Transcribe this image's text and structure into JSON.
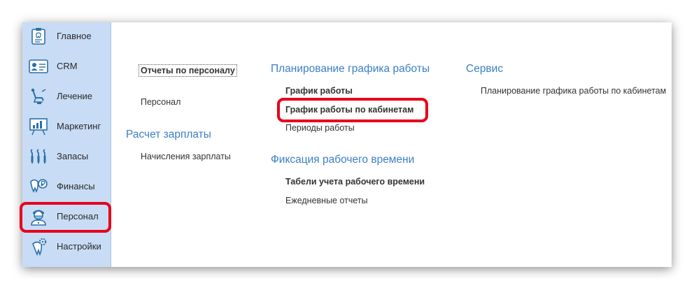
{
  "sidebar": {
    "items": [
      {
        "label": "Главное",
        "icon": "clipboard-tooth-icon"
      },
      {
        "label": "CRM",
        "icon": "contact-card-icon"
      },
      {
        "label": "Лечение",
        "icon": "dental-chair-icon"
      },
      {
        "label": "Маркетинг",
        "icon": "presentation-board-icon"
      },
      {
        "label": "Запасы",
        "icon": "dental-tools-icon"
      },
      {
        "label": "Финансы",
        "icon": "tooth-coin-icon"
      },
      {
        "label": "Персонал",
        "icon": "doctor-icon"
      },
      {
        "label": "Настройки",
        "icon": "tooth-gear-icon"
      }
    ],
    "selected": "Персонал"
  },
  "main": {
    "col1": {
      "reports_link": "Отчеты по персоналу",
      "staff_link": "Персонал",
      "salary_section": "Расчет зарплаты",
      "salary_accruals_link": "Начисления зарплаты"
    },
    "col2": {
      "planning_section": "Планирование графика работы",
      "schedule_link": "График работы",
      "room_schedule_link": "График работы по кабинетам",
      "work_periods_link": "Периоды работы",
      "time_tracking_section": "Фиксация рабочего времени",
      "timesheets_link": "Табели учета рабочего времени",
      "daily_reports_link": "Ежедневные отчеты"
    },
    "col3": {
      "service_section": "Сервис",
      "room_planning_link": "Планирование графика работы по кабинетам"
    }
  },
  "colors": {
    "sidebar_bg": "#c8dcf5",
    "section_title": "#3b7fc4",
    "highlight": "#e8001b"
  }
}
